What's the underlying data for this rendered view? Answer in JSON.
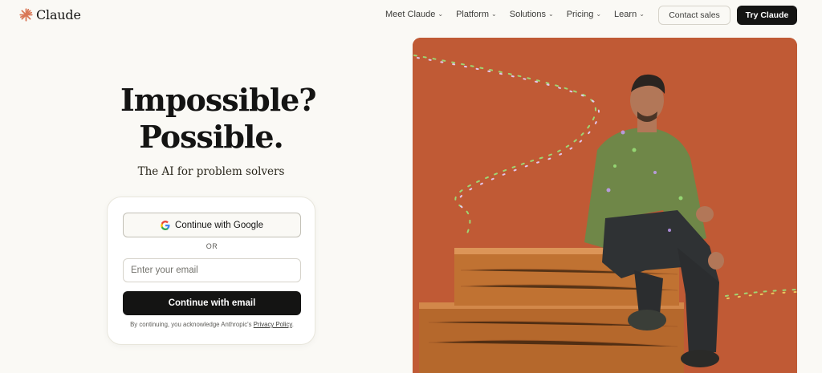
{
  "brand": {
    "name": "Claude",
    "accent": "#d97757"
  },
  "nav": {
    "links": [
      {
        "label": "Meet Claude"
      },
      {
        "label": "Platform"
      },
      {
        "label": "Solutions"
      },
      {
        "label": "Pricing"
      },
      {
        "label": "Learn"
      }
    ],
    "contact_label": "Contact sales",
    "try_label": "Try Claude",
    "dropdown_icon": "chevron-down-icon"
  },
  "hero": {
    "title_line1": "Impossible?",
    "title_line2": "Possible.",
    "subtitle": "The AI for problem solvers"
  },
  "signup": {
    "google_label": "Continue with Google",
    "or_label": "OR",
    "email_placeholder": "Enter your email",
    "email_value": "",
    "email_button_label": "Continue with email",
    "legal_prefix": "By continuing, you acknowledge Anthropic's",
    "legal_link": "Privacy Policy",
    "legal_suffix": "."
  },
  "colors": {
    "background": "#faf9f5",
    "primary_button": "#141413",
    "photo_background": "#c05a35"
  }
}
